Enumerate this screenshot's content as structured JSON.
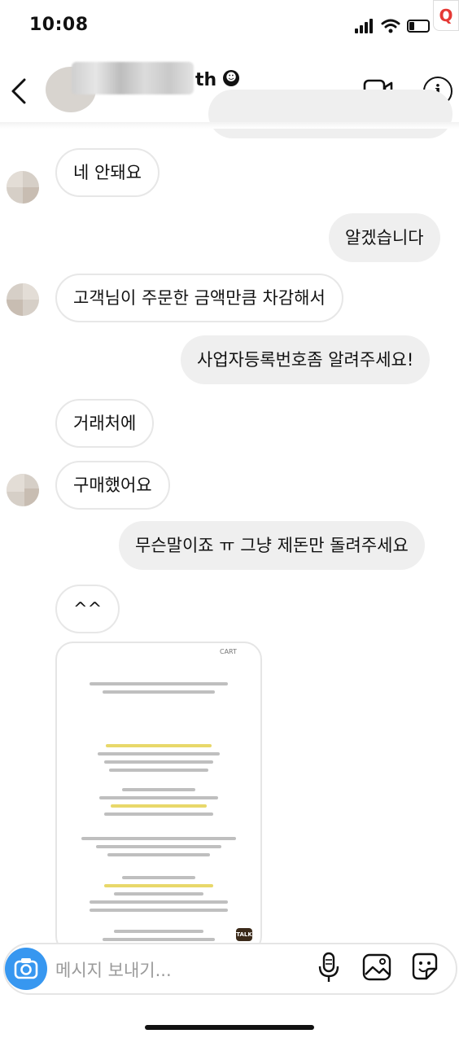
{
  "status_bar": {
    "time": "10:08"
  },
  "header": {
    "name_visible_suffix": "th",
    "name_emoji": "☻"
  },
  "messages": [
    {
      "dir": "in",
      "text": "네 안돼요"
    },
    {
      "dir": "out",
      "text": "알겠습니다"
    },
    {
      "dir": "in",
      "text": "고객님이 주문한 금액만큼 차감해서"
    },
    {
      "dir": "out",
      "text": "사업자등록번호좀 알려주세요!"
    },
    {
      "dir": "in",
      "text": "거래처에"
    },
    {
      "dir": "in",
      "text": "구매했어요"
    },
    {
      "dir": "out",
      "text": "무슨말이죠 ㅠ 그냥 제돈만 돌려주세요"
    },
    {
      "dir": "in",
      "text": "^^"
    }
  ],
  "shared_image": {
    "top_label": "CART",
    "badge": "TALK"
  },
  "composer": {
    "placeholder": "메시지 보내기..."
  },
  "colors": {
    "accent": "#3797f0",
    "incoming_border": "#e7e7e7",
    "outgoing_bg": "#efefef"
  }
}
